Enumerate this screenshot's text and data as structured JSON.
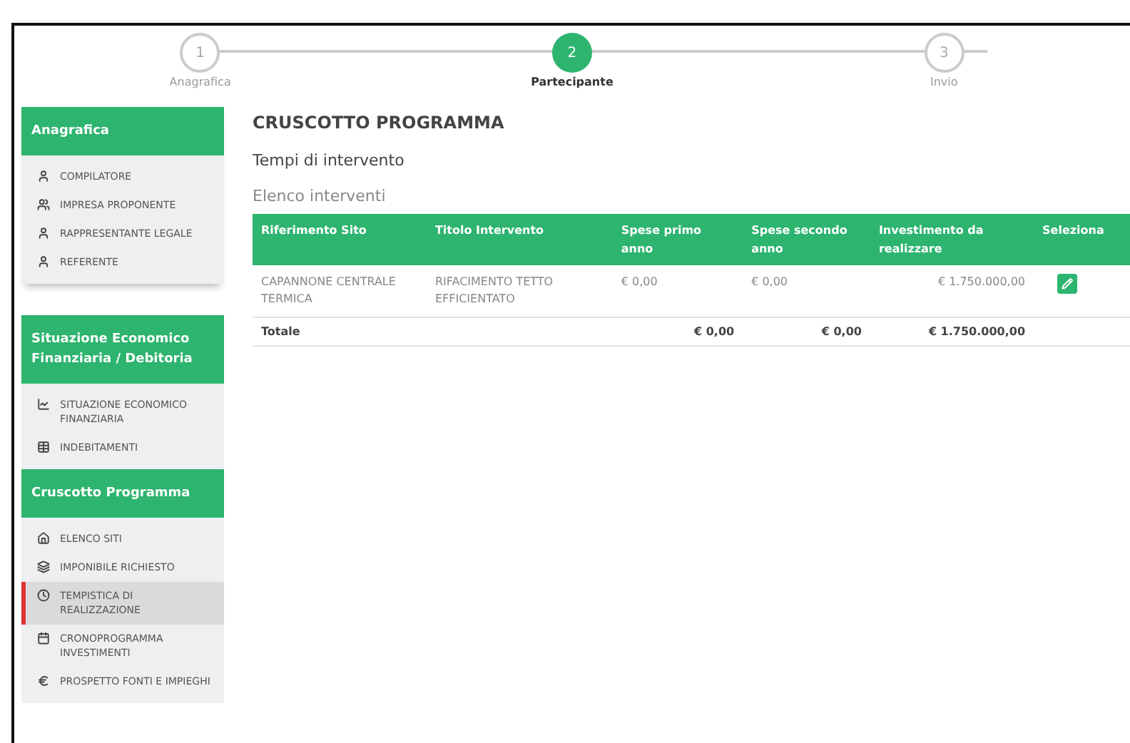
{
  "stepper": [
    {
      "number": "1",
      "label": "Anagrafica",
      "selected": false
    },
    {
      "number": "2",
      "label": "Partecipante",
      "selected": true
    },
    {
      "number": "3",
      "label": "Invio",
      "selected": false
    }
  ],
  "sidebar": [
    {
      "title": "Anagrafica",
      "items": [
        {
          "label": "COMPILATORE",
          "kind": "user",
          "selected": false
        },
        {
          "label": "IMPRESA PROPONENTE",
          "kind": "users",
          "selected": false
        },
        {
          "label": "RAPPRESENTANTE LEGALE",
          "kind": "user",
          "selected": false
        },
        {
          "label": "REFERENTE",
          "kind": "user",
          "selected": false
        }
      ]
    },
    {
      "title": "Situazione Economico Finanziaria / Debitoria",
      "items": [
        {
          "label": "SITUAZIONE ECONOMICO FINANZIARIA",
          "kind": "chart",
          "selected": false
        },
        {
          "label": "INDEBITAMENTI",
          "kind": "table",
          "selected": false
        }
      ]
    },
    {
      "title": "Cruscotto Programma",
      "items": [
        {
          "label": "ELENCO SITI",
          "kind": "home",
          "selected": false
        },
        {
          "label": "IMPONIBILE RICHIESTO",
          "kind": "stack",
          "selected": false
        },
        {
          "label": "TEMPISTICA DI REALIZZAZIONE",
          "kind": "clock",
          "selected": true
        },
        {
          "label": "CRONOPROGRAMMA INVESTIMENTI",
          "kind": "calendar",
          "selected": false
        },
        {
          "label": "PROSPETTO FONTI E IMPIEGHI",
          "kind": "euro",
          "selected": false
        }
      ]
    }
  ],
  "page_title": "CRUSCOTTO PROGRAMMA",
  "section_title": "Tempi di intervento",
  "table_title": "Elenco interventi",
  "table": {
    "columns": [
      "Riferimento Sito",
      "Titolo Intervento",
      "Spese primo anno",
      "Spese secondo anno",
      "Investimento da realizzare",
      "Seleziona"
    ],
    "rows": [
      {
        "cells": [
          "CAPANNONE CENTRALE TERMICA",
          "RIFACIMENTO TETTO EFFICIENTATO",
          "€ 0,00",
          "€ 0,00",
          "€ 1.750.000,00"
        ]
      }
    ],
    "total": {
      "label": "Totale",
      "cells": [
        "€ 0,00",
        "€ 0,00",
        "€ 1.750.000,00"
      ]
    }
  }
}
